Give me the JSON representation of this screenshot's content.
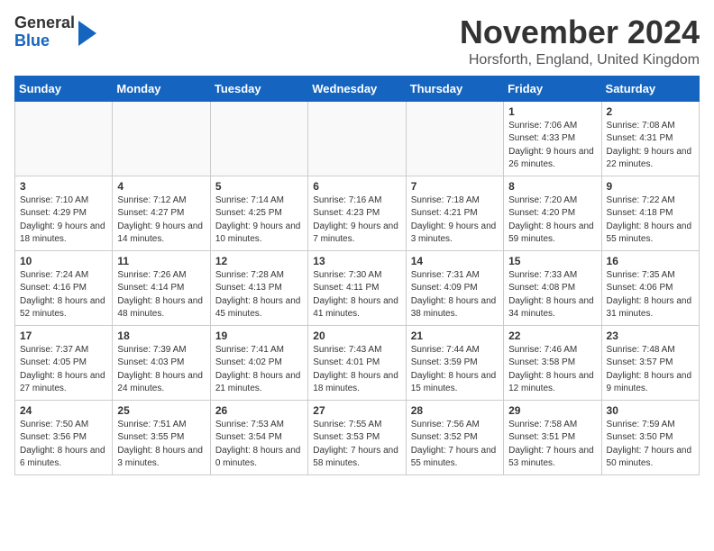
{
  "logo": {
    "line1": "General",
    "line2": "Blue"
  },
  "title": "November 2024",
  "location": "Horsforth, England, United Kingdom",
  "days_of_week": [
    "Sunday",
    "Monday",
    "Tuesday",
    "Wednesday",
    "Thursday",
    "Friday",
    "Saturday"
  ],
  "weeks": [
    [
      {
        "day": "",
        "info": ""
      },
      {
        "day": "",
        "info": ""
      },
      {
        "day": "",
        "info": ""
      },
      {
        "day": "",
        "info": ""
      },
      {
        "day": "",
        "info": ""
      },
      {
        "day": "1",
        "info": "Sunrise: 7:06 AM\nSunset: 4:33 PM\nDaylight: 9 hours and 26 minutes."
      },
      {
        "day": "2",
        "info": "Sunrise: 7:08 AM\nSunset: 4:31 PM\nDaylight: 9 hours and 22 minutes."
      }
    ],
    [
      {
        "day": "3",
        "info": "Sunrise: 7:10 AM\nSunset: 4:29 PM\nDaylight: 9 hours and 18 minutes."
      },
      {
        "day": "4",
        "info": "Sunrise: 7:12 AM\nSunset: 4:27 PM\nDaylight: 9 hours and 14 minutes."
      },
      {
        "day": "5",
        "info": "Sunrise: 7:14 AM\nSunset: 4:25 PM\nDaylight: 9 hours and 10 minutes."
      },
      {
        "day": "6",
        "info": "Sunrise: 7:16 AM\nSunset: 4:23 PM\nDaylight: 9 hours and 7 minutes."
      },
      {
        "day": "7",
        "info": "Sunrise: 7:18 AM\nSunset: 4:21 PM\nDaylight: 9 hours and 3 minutes."
      },
      {
        "day": "8",
        "info": "Sunrise: 7:20 AM\nSunset: 4:20 PM\nDaylight: 8 hours and 59 minutes."
      },
      {
        "day": "9",
        "info": "Sunrise: 7:22 AM\nSunset: 4:18 PM\nDaylight: 8 hours and 55 minutes."
      }
    ],
    [
      {
        "day": "10",
        "info": "Sunrise: 7:24 AM\nSunset: 4:16 PM\nDaylight: 8 hours and 52 minutes."
      },
      {
        "day": "11",
        "info": "Sunrise: 7:26 AM\nSunset: 4:14 PM\nDaylight: 8 hours and 48 minutes."
      },
      {
        "day": "12",
        "info": "Sunrise: 7:28 AM\nSunset: 4:13 PM\nDaylight: 8 hours and 45 minutes."
      },
      {
        "day": "13",
        "info": "Sunrise: 7:30 AM\nSunset: 4:11 PM\nDaylight: 8 hours and 41 minutes."
      },
      {
        "day": "14",
        "info": "Sunrise: 7:31 AM\nSunset: 4:09 PM\nDaylight: 8 hours and 38 minutes."
      },
      {
        "day": "15",
        "info": "Sunrise: 7:33 AM\nSunset: 4:08 PM\nDaylight: 8 hours and 34 minutes."
      },
      {
        "day": "16",
        "info": "Sunrise: 7:35 AM\nSunset: 4:06 PM\nDaylight: 8 hours and 31 minutes."
      }
    ],
    [
      {
        "day": "17",
        "info": "Sunrise: 7:37 AM\nSunset: 4:05 PM\nDaylight: 8 hours and 27 minutes."
      },
      {
        "day": "18",
        "info": "Sunrise: 7:39 AM\nSunset: 4:03 PM\nDaylight: 8 hours and 24 minutes."
      },
      {
        "day": "19",
        "info": "Sunrise: 7:41 AM\nSunset: 4:02 PM\nDaylight: 8 hours and 21 minutes."
      },
      {
        "day": "20",
        "info": "Sunrise: 7:43 AM\nSunset: 4:01 PM\nDaylight: 8 hours and 18 minutes."
      },
      {
        "day": "21",
        "info": "Sunrise: 7:44 AM\nSunset: 3:59 PM\nDaylight: 8 hours and 15 minutes."
      },
      {
        "day": "22",
        "info": "Sunrise: 7:46 AM\nSunset: 3:58 PM\nDaylight: 8 hours and 12 minutes."
      },
      {
        "day": "23",
        "info": "Sunrise: 7:48 AM\nSunset: 3:57 PM\nDaylight: 8 hours and 9 minutes."
      }
    ],
    [
      {
        "day": "24",
        "info": "Sunrise: 7:50 AM\nSunset: 3:56 PM\nDaylight: 8 hours and 6 minutes."
      },
      {
        "day": "25",
        "info": "Sunrise: 7:51 AM\nSunset: 3:55 PM\nDaylight: 8 hours and 3 minutes."
      },
      {
        "day": "26",
        "info": "Sunrise: 7:53 AM\nSunset: 3:54 PM\nDaylight: 8 hours and 0 minutes."
      },
      {
        "day": "27",
        "info": "Sunrise: 7:55 AM\nSunset: 3:53 PM\nDaylight: 7 hours and 58 minutes."
      },
      {
        "day": "28",
        "info": "Sunrise: 7:56 AM\nSunset: 3:52 PM\nDaylight: 7 hours and 55 minutes."
      },
      {
        "day": "29",
        "info": "Sunrise: 7:58 AM\nSunset: 3:51 PM\nDaylight: 7 hours and 53 minutes."
      },
      {
        "day": "30",
        "info": "Sunrise: 7:59 AM\nSunset: 3:50 PM\nDaylight: 7 hours and 50 minutes."
      }
    ]
  ]
}
